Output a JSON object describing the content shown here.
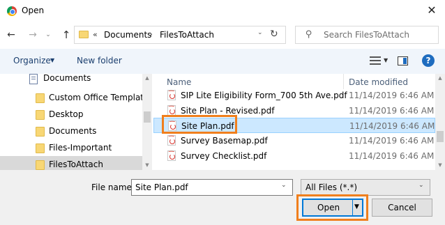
{
  "window": {
    "title": "Open",
    "close_glyph": "✕"
  },
  "nav": {
    "back_glyph": "←",
    "forward_glyph": "→",
    "history_glyph": "⌄",
    "up_glyph": "↑",
    "address": {
      "overflow": "«",
      "crumbs": [
        "Documents",
        "FilesToAttach"
      ],
      "separator": "›",
      "dropdown_glyph": "⌄",
      "refresh_glyph": "↻"
    },
    "search": {
      "placeholder": "Search FilesToAttach",
      "icon_glyph": "⚲"
    }
  },
  "toolbar": {
    "organize": "Organize",
    "caret": "▼",
    "new_folder": "New folder",
    "help": "?"
  },
  "nav_pane": {
    "header": "Documents",
    "items": [
      "Custom Office Templates",
      "Desktop",
      "Documents",
      "Files-Important",
      "FilesToAttach"
    ],
    "selected_index": 4,
    "scroll_up": "▲",
    "scroll_down": "▼"
  },
  "file_list": {
    "sort_glyph": "⌃",
    "columns": {
      "name": "Name",
      "date": "Date modified"
    },
    "files": [
      {
        "name": "SIP Lite Eligibility Form_700 5th Ave.pdf",
        "date": "11/14/2019 6:46 AM"
      },
      {
        "name": "Site Plan - Revised.pdf",
        "date": "11/14/2019 6:46 AM"
      },
      {
        "name": "Site Plan.pdf",
        "date": "11/14/2019 6:46 AM"
      },
      {
        "name": "Survey Basemap.pdf",
        "date": "11/14/2019 6:46 AM"
      },
      {
        "name": "Survey Checklist.pdf",
        "date": "11/14/2019 6:46 AM"
      }
    ],
    "selected_index": 2
  },
  "bottom": {
    "filename_label": "File name:",
    "filename_value": "Site Plan.pdf",
    "filetype_value": "All Files (*.*)",
    "dropdown_glyph": "⌄",
    "open": "Open",
    "open_arrow": "▼",
    "cancel": "Cancel"
  },
  "colors": {
    "highlight": "#f07f1d",
    "selection": "#cce8ff",
    "accent": "#0078d7"
  }
}
